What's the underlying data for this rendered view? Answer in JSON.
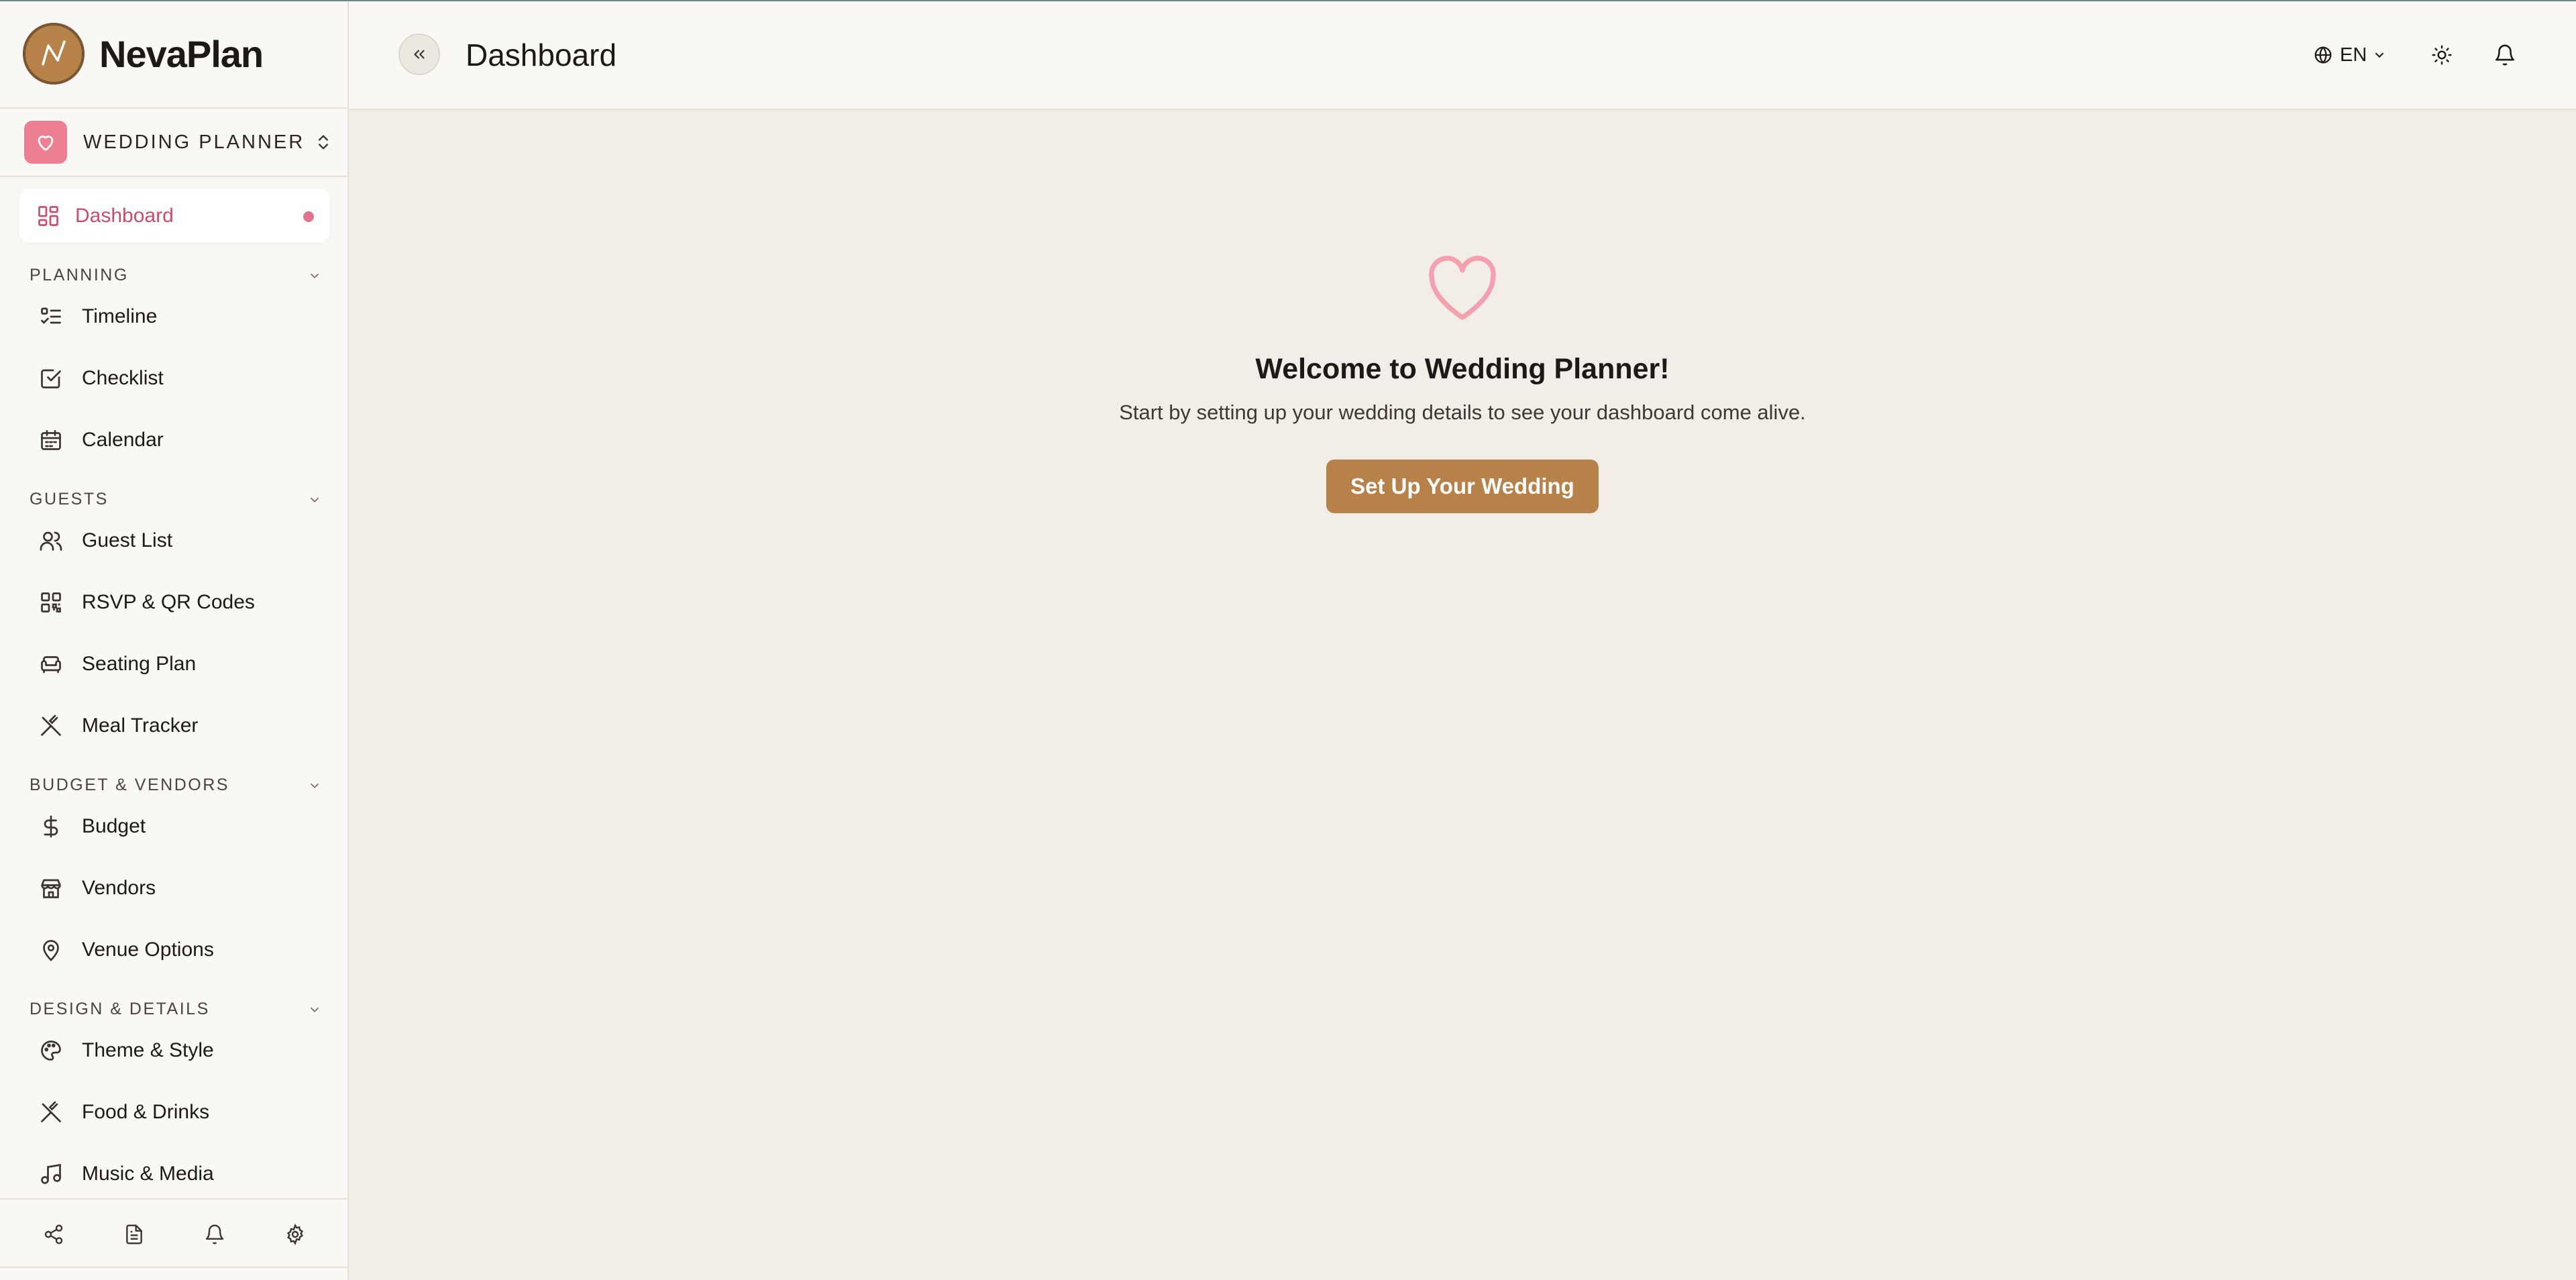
{
  "app": {
    "name": "NevaPlan"
  },
  "workspace": {
    "label": "WEDDING PLANNER"
  },
  "sidebar": {
    "active": {
      "label": "Dashboard"
    },
    "sections": [
      {
        "label": "PLANNING",
        "items": [
          {
            "label": "Timeline"
          },
          {
            "label": "Checklist"
          },
          {
            "label": "Calendar"
          }
        ]
      },
      {
        "label": "GUESTS",
        "items": [
          {
            "label": "Guest List"
          },
          {
            "label": "RSVP & QR Codes"
          },
          {
            "label": "Seating Plan"
          },
          {
            "label": "Meal Tracker"
          }
        ]
      },
      {
        "label": "BUDGET & VENDORS",
        "items": [
          {
            "label": "Budget"
          },
          {
            "label": "Vendors"
          },
          {
            "label": "Venue Options"
          }
        ]
      },
      {
        "label": "DESIGN & DETAILS",
        "items": [
          {
            "label": "Theme & Style"
          },
          {
            "label": "Food & Drinks"
          },
          {
            "label": "Music & Media"
          }
        ]
      }
    ]
  },
  "header": {
    "title": "Dashboard",
    "language": "EN"
  },
  "main": {
    "welcome_title": "Welcome to Wedding Planner!",
    "welcome_subtitle": "Start by setting up your wedding details to see your dashboard come alive.",
    "cta_label": "Set Up Your Wedding"
  },
  "colors": {
    "accent": "#b7814a",
    "pink": "#e2738c",
    "background": "#f2ede6"
  }
}
